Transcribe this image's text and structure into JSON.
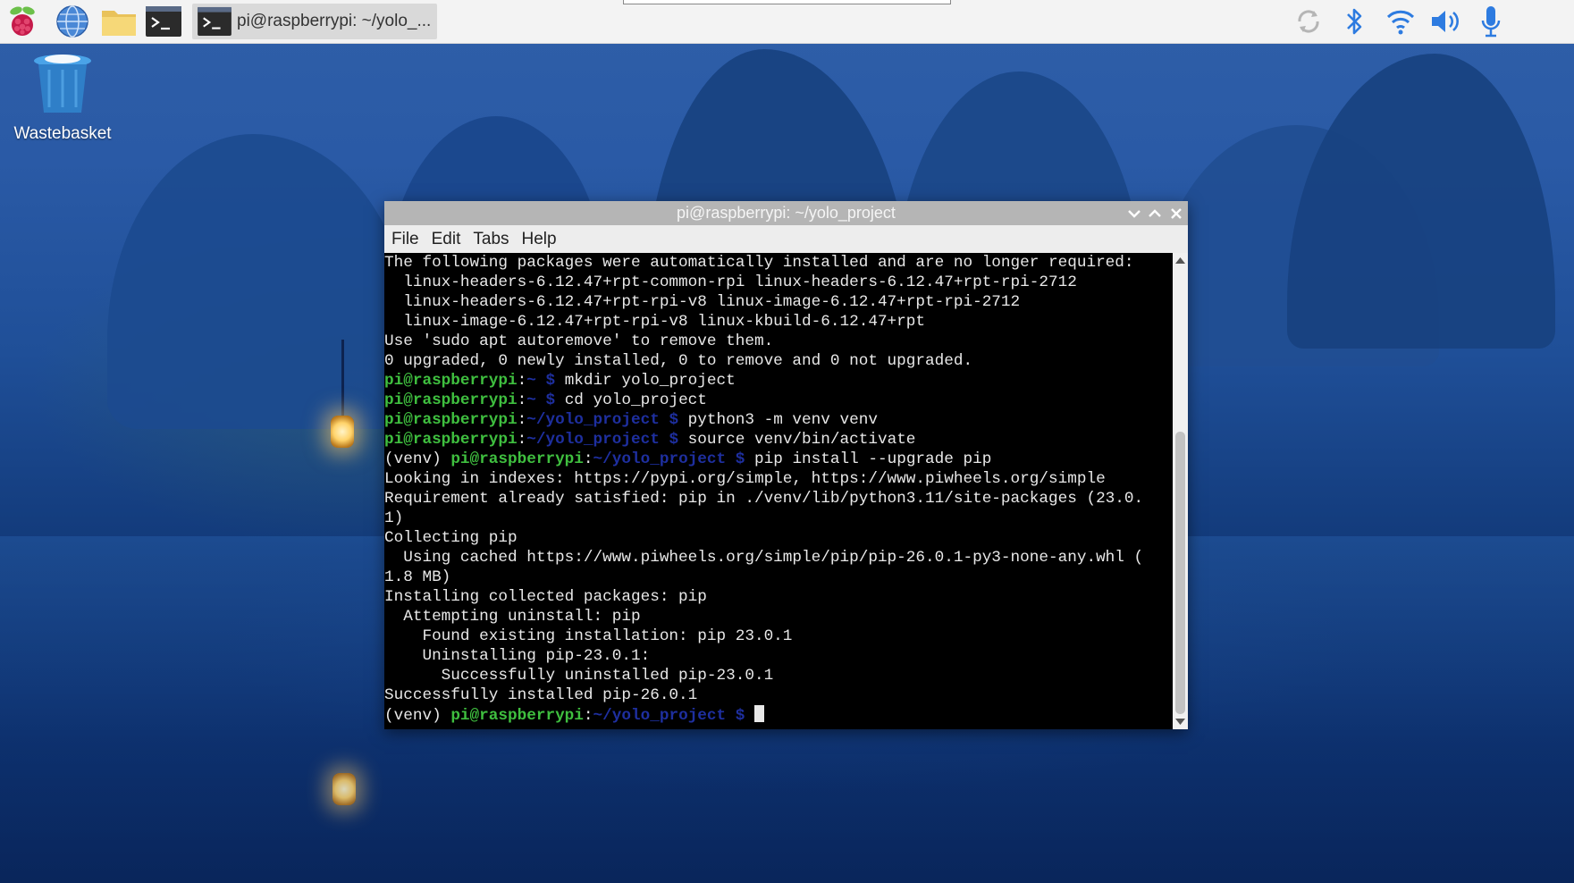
{
  "taskbar": {
    "launchers": [
      "raspberry-pi-menu",
      "web-browser",
      "file-manager",
      "terminal"
    ],
    "active_task": "pi@raspberrypi: ~/yolo_...",
    "tray": [
      "sync-icon",
      "bluetooth-icon",
      "wifi-icon",
      "volume-icon",
      "microphone-icon"
    ]
  },
  "desktop": {
    "trash_label": "Wastebasket"
  },
  "window": {
    "title": "pi@raspberrypi: ~/yolo_project",
    "menu": [
      "File",
      "Edit",
      "Tabs",
      "Help"
    ],
    "lines": [
      {
        "text": "The following packages were automatically installed and are no longer required:"
      },
      {
        "text": "  linux-headers-6.12.47+rpt-common-rpi linux-headers-6.12.47+rpt-rpi-2712"
      },
      {
        "text": "  linux-headers-6.12.47+rpt-rpi-v8 linux-image-6.12.47+rpt-rpi-2712"
      },
      {
        "text": "  linux-image-6.12.47+rpt-rpi-v8 linux-kbuild-6.12.47+rpt"
      },
      {
        "text": "Use 'sudo apt autoremove' to remove them."
      },
      {
        "text": "0 upgraded, 0 newly installed, 0 to remove and 0 not upgraded."
      },
      {
        "prefix": "",
        "user": "pi@raspberrypi",
        "sep": ":",
        "path": "~ $",
        "cmd": " mkdir yolo_project"
      },
      {
        "prefix": "",
        "user": "pi@raspberrypi",
        "sep": ":",
        "path": "~ $",
        "cmd": " cd yolo_project"
      },
      {
        "prefix": "",
        "user": "pi@raspberrypi",
        "sep": ":",
        "path": "~/yolo_project $",
        "cmd": " python3 -m venv venv"
      },
      {
        "prefix": "",
        "user": "pi@raspberrypi",
        "sep": ":",
        "path": "~/yolo_project $",
        "cmd": " source venv/bin/activate"
      },
      {
        "prefix": "(venv) ",
        "user": "pi@raspberrypi",
        "sep": ":",
        "path": "~/yolo_project $",
        "cmd": " pip install --upgrade pip"
      },
      {
        "text": "Looking in indexes: https://pypi.org/simple, https://www.piwheels.org/simple"
      },
      {
        "text": "Requirement already satisfied: pip in ./venv/lib/python3.11/site-packages (23.0."
      },
      {
        "text": "1)"
      },
      {
        "text": "Collecting pip"
      },
      {
        "text": "  Using cached https://www.piwheels.org/simple/pip/pip-26.0.1-py3-none-any.whl ("
      },
      {
        "text": "1.8 MB)"
      },
      {
        "text": "Installing collected packages: pip"
      },
      {
        "text": "  Attempting uninstall: pip"
      },
      {
        "text": "    Found existing installation: pip 23.0.1"
      },
      {
        "text": "    Uninstalling pip-23.0.1:"
      },
      {
        "text": "      Successfully uninstalled pip-23.0.1"
      },
      {
        "text": "Successfully installed pip-26.0.1"
      },
      {
        "prefix": "(venv) ",
        "user": "pi@raspberrypi",
        "sep": ":",
        "path": "~/yolo_project $",
        "cmd": " ",
        "cursor": true
      }
    ]
  },
  "colors": {
    "prompt_user": "#3fbf3f",
    "prompt_path": "#1e2f9f",
    "terminal_bg": "#000000",
    "terminal_fg": "#e8e8e8"
  }
}
